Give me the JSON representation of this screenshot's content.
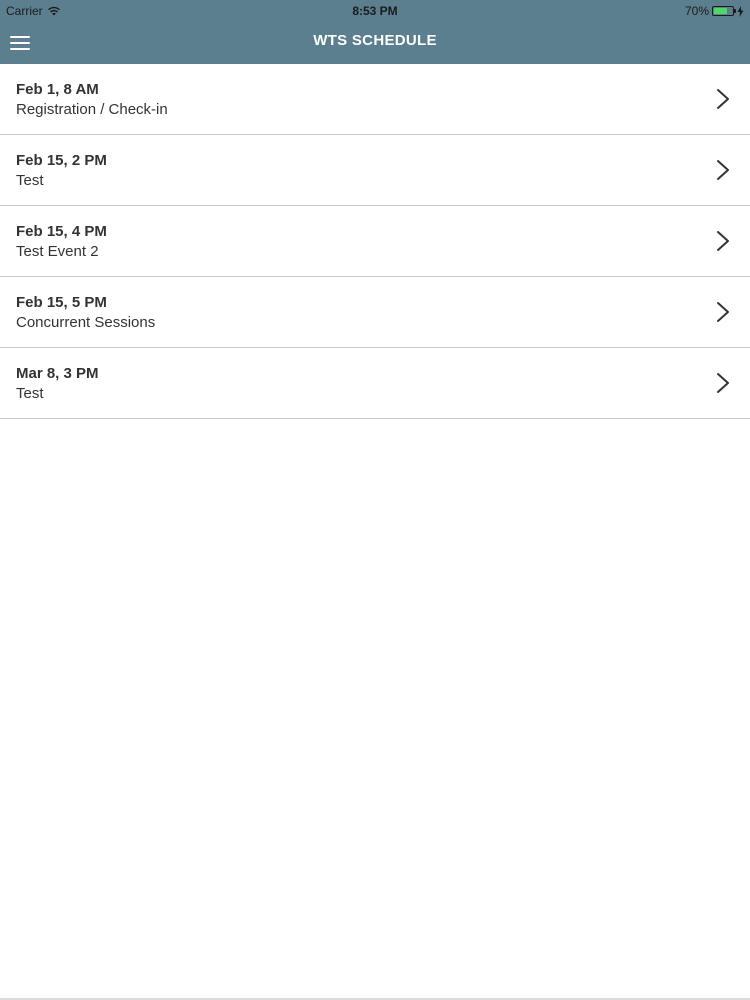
{
  "status_bar": {
    "carrier": "Carrier",
    "time": "8:53 PM",
    "battery_percent": "70%",
    "battery_level": 0.7
  },
  "nav": {
    "title": "WTS SCHEDULE",
    "menu_icon": "hamburger-menu-icon"
  },
  "colors": {
    "header_bg": "#5b7f8e",
    "battery_fill": "#4cd964"
  },
  "schedule": {
    "items": [
      {
        "date": "Feb 1, 8 AM",
        "title": "Registration / Check-in"
      },
      {
        "date": "Feb 15, 2 PM",
        "title": "Test"
      },
      {
        "date": "Feb 15, 4 PM",
        "title": "Test Event 2"
      },
      {
        "date": "Feb 15, 5 PM",
        "title": "Concurrent Sessions"
      },
      {
        "date": "Mar 8, 3 PM",
        "title": "Test"
      }
    ]
  }
}
